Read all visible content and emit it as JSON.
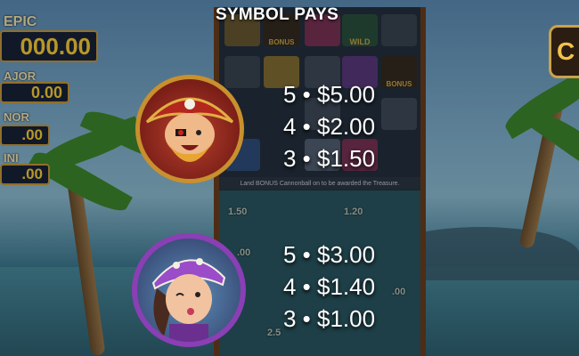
{
  "title": "SYMBOL PAYS",
  "jackpots": [
    {
      "label": "EPIC",
      "value": "000.00"
    },
    {
      "label": "AJOR",
      "value": "0.00"
    },
    {
      "label": "NOR",
      "value": ".00"
    },
    {
      "label": "INI",
      "value": ".00"
    }
  ],
  "reel_labels": {
    "bonus_top": "BONUS",
    "wild_top": "WILD",
    "bonus_mid": "BONUS",
    "bonus_strip": "Land BONUS Cannonball on      to be awarded the Treasure."
  },
  "coin_values": [
    "1.50",
    "1.20",
    ".00",
    ".00",
    "2.5"
  ],
  "symbols": [
    {
      "name": "Pirate Captain",
      "pays": [
        "5 • $5.00",
        "4 • $2.00",
        "3 • $1.50"
      ],
      "ring_color": "#c8902e"
    },
    {
      "name": "Pirate Girl",
      "pays": [
        "5 • $3.00",
        "4 • $1.40",
        "3 • $1.00"
      ],
      "ring_color": "#8a3fb5"
    }
  ]
}
